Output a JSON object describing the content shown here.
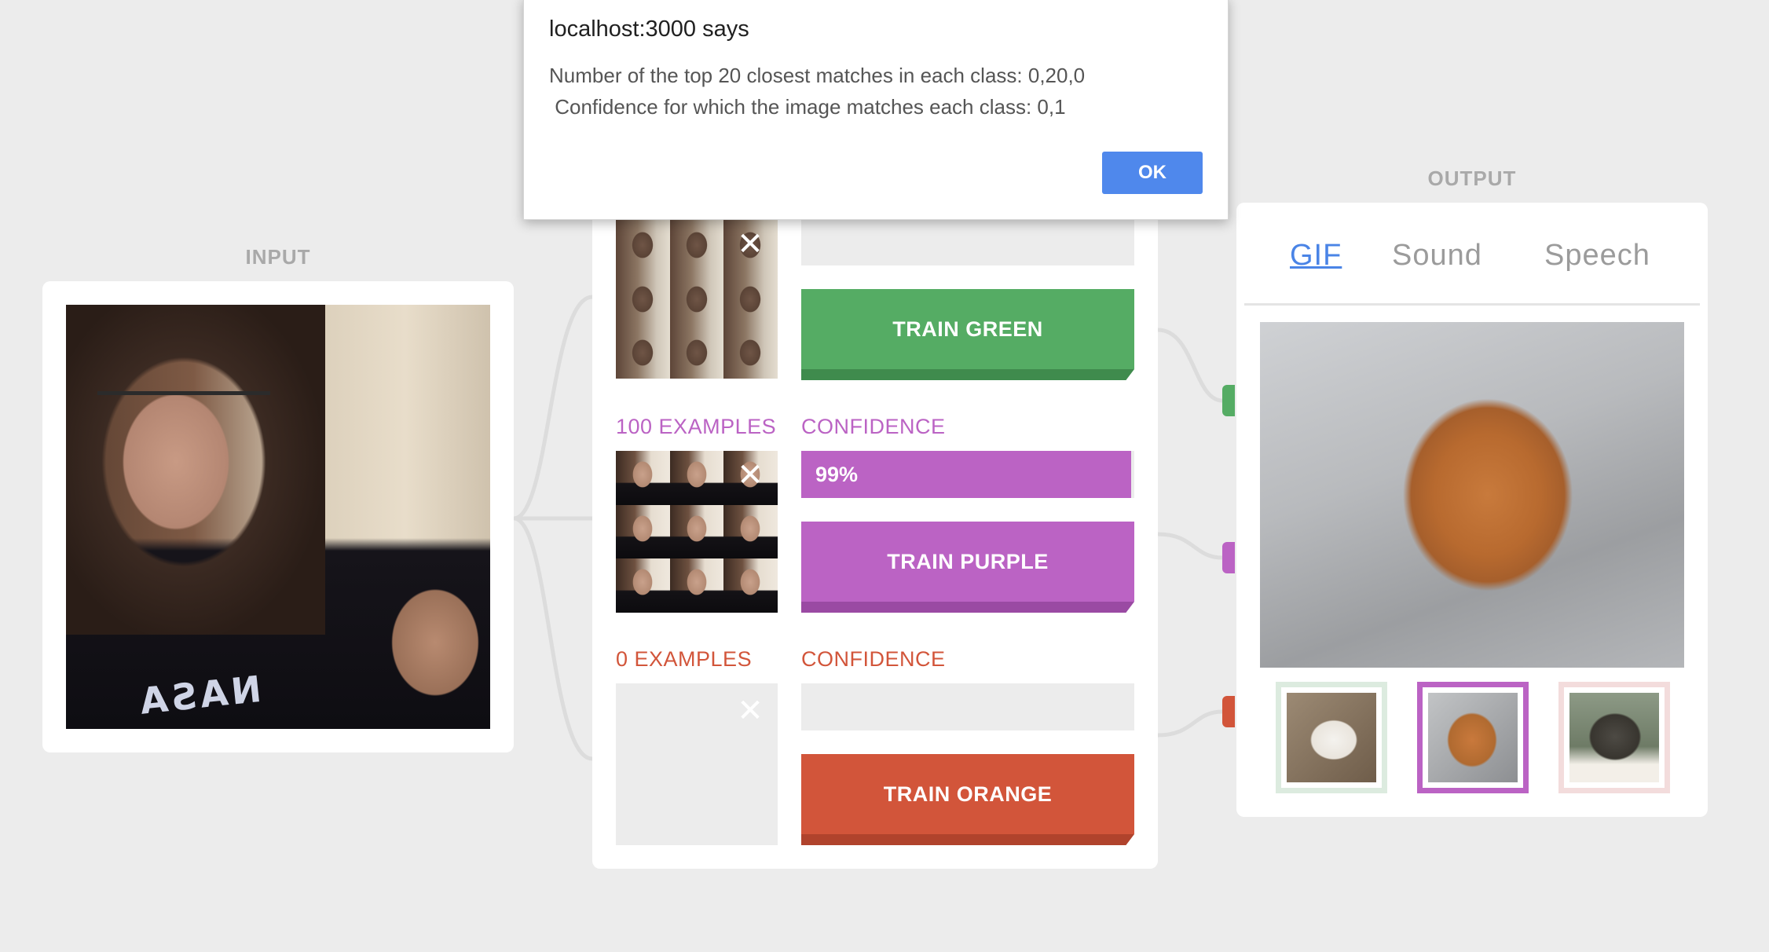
{
  "colors": {
    "page_bg": "#ececec",
    "green": "#55ac64",
    "green_dark": "#3f8b4d",
    "purple": "#bb63c4",
    "purple_dark": "#9a4aa3",
    "orange": "#d2553a",
    "orange_dark": "#b0432c",
    "accent_blue": "#4f88ec"
  },
  "input": {
    "label": "INPUT"
  },
  "classes": [
    {
      "id": "green",
      "examples_label": "",
      "confidence_label": "",
      "confidence_value": "",
      "confidence_fraction": 0,
      "train_label": "TRAIN GREEN"
    },
    {
      "id": "purple",
      "examples_label": "100 EXAMPLES",
      "confidence_label": "CONFIDENCE",
      "confidence_value": "99%",
      "confidence_fraction": 0.99,
      "train_label": "TRAIN PURPLE"
    },
    {
      "id": "orange",
      "examples_label": "0 EXAMPLES",
      "confidence_label": "CONFIDENCE",
      "confidence_value": "",
      "confidence_fraction": 0,
      "train_label": "TRAIN ORANGE"
    }
  ],
  "output": {
    "label": "OUTPUT",
    "tabs": [
      "GIF",
      "Sound",
      "Speech"
    ],
    "active_tab": "GIF",
    "selected_gif": 2
  },
  "dialog": {
    "title": "localhost:3000 says",
    "line1": "Number of the top 20 closest matches in each class: 0,20,0",
    "line2": " Confidence for which the image matches each class: 0,1",
    "ok_label": "OK"
  },
  "icons": {
    "remove": "close-icon"
  }
}
